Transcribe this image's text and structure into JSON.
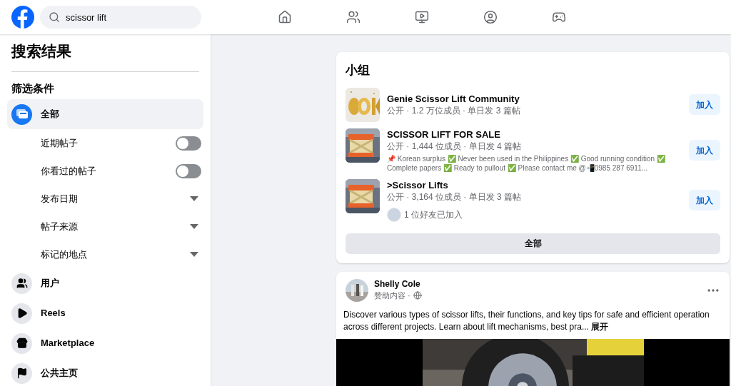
{
  "header": {
    "search": {
      "value": "scissor lift"
    },
    "nav": [
      {
        "kind": "home",
        "selected": false
      },
      {
        "kind": "friends",
        "selected": false
      },
      {
        "kind": "video",
        "selected": false
      },
      {
        "kind": "groups",
        "selected": false
      },
      {
        "kind": "gaming",
        "selected": false
      }
    ]
  },
  "sidebar": {
    "title": "搜索结果",
    "filters_heading": "筛选条件",
    "items": [
      {
        "label": "全部",
        "kind": "all",
        "selected": true,
        "children": [
          {
            "label": "近期帖子",
            "kind": "toggle",
            "on": false
          },
          {
            "label": "你看过的帖子",
            "kind": "toggle",
            "on": false
          },
          {
            "label": "发布日期",
            "kind": "dropdown"
          },
          {
            "label": "帖子来源",
            "kind": "dropdown"
          },
          {
            "label": "标记的地点",
            "kind": "dropdown"
          }
        ]
      },
      {
        "label": "用户",
        "kind": "people",
        "selected": false
      },
      {
        "label": "Reels",
        "kind": "reels",
        "selected": false
      },
      {
        "label": "Marketplace",
        "kind": "marketplace",
        "selected": false
      },
      {
        "label": "公共主页",
        "kind": "pages",
        "selected": false
      }
    ]
  },
  "groups": {
    "title": "小组",
    "items": [
      {
        "name": "Genie Scissor Lift Community",
        "meta": "公开 · 1.2 万位成员 · 单日发 3 篇帖",
        "button": "加入"
      },
      {
        "name": "SCISSOR LIFT FOR SALE",
        "meta": "公开 · 1,444 位成员 · 单日发 4 篇帖",
        "description": "📌 Korean surplus ✅ Never been used in the Philippines ✅ Good running condition ✅ Complete papers ✅ Ready to pullout ✅ Please contact me @📲0985 287 6911...",
        "button": "加入"
      },
      {
        "name": ">Scissor Lifts",
        "meta": "公开 · 3,164 位成员 · 单日发 3 篇帖",
        "friends": "1 位好友已加入",
        "button": "加入"
      }
    ],
    "see_all": "全部"
  },
  "post": {
    "author": "Shelly Cole",
    "subtitle": "赞助内容 ·",
    "text": "Discover various types of scissor lifts, their functions, and key tips for safe and efficient operation across different projects. Learn about lift mechanisms, best pra...",
    "more": "展开"
  }
}
